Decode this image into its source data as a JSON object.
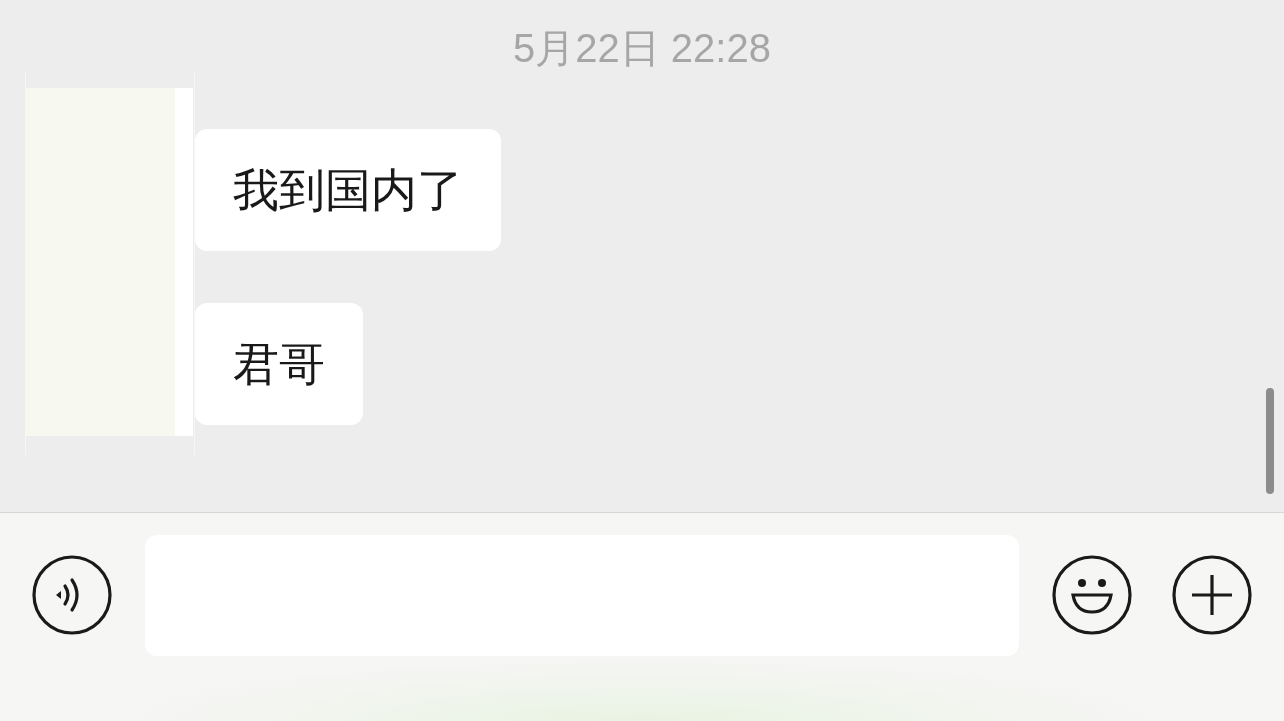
{
  "timestamp": "5月22日 22:28",
  "messages": [
    {
      "text": "我到国内了"
    },
    {
      "text": "君哥"
    }
  ]
}
